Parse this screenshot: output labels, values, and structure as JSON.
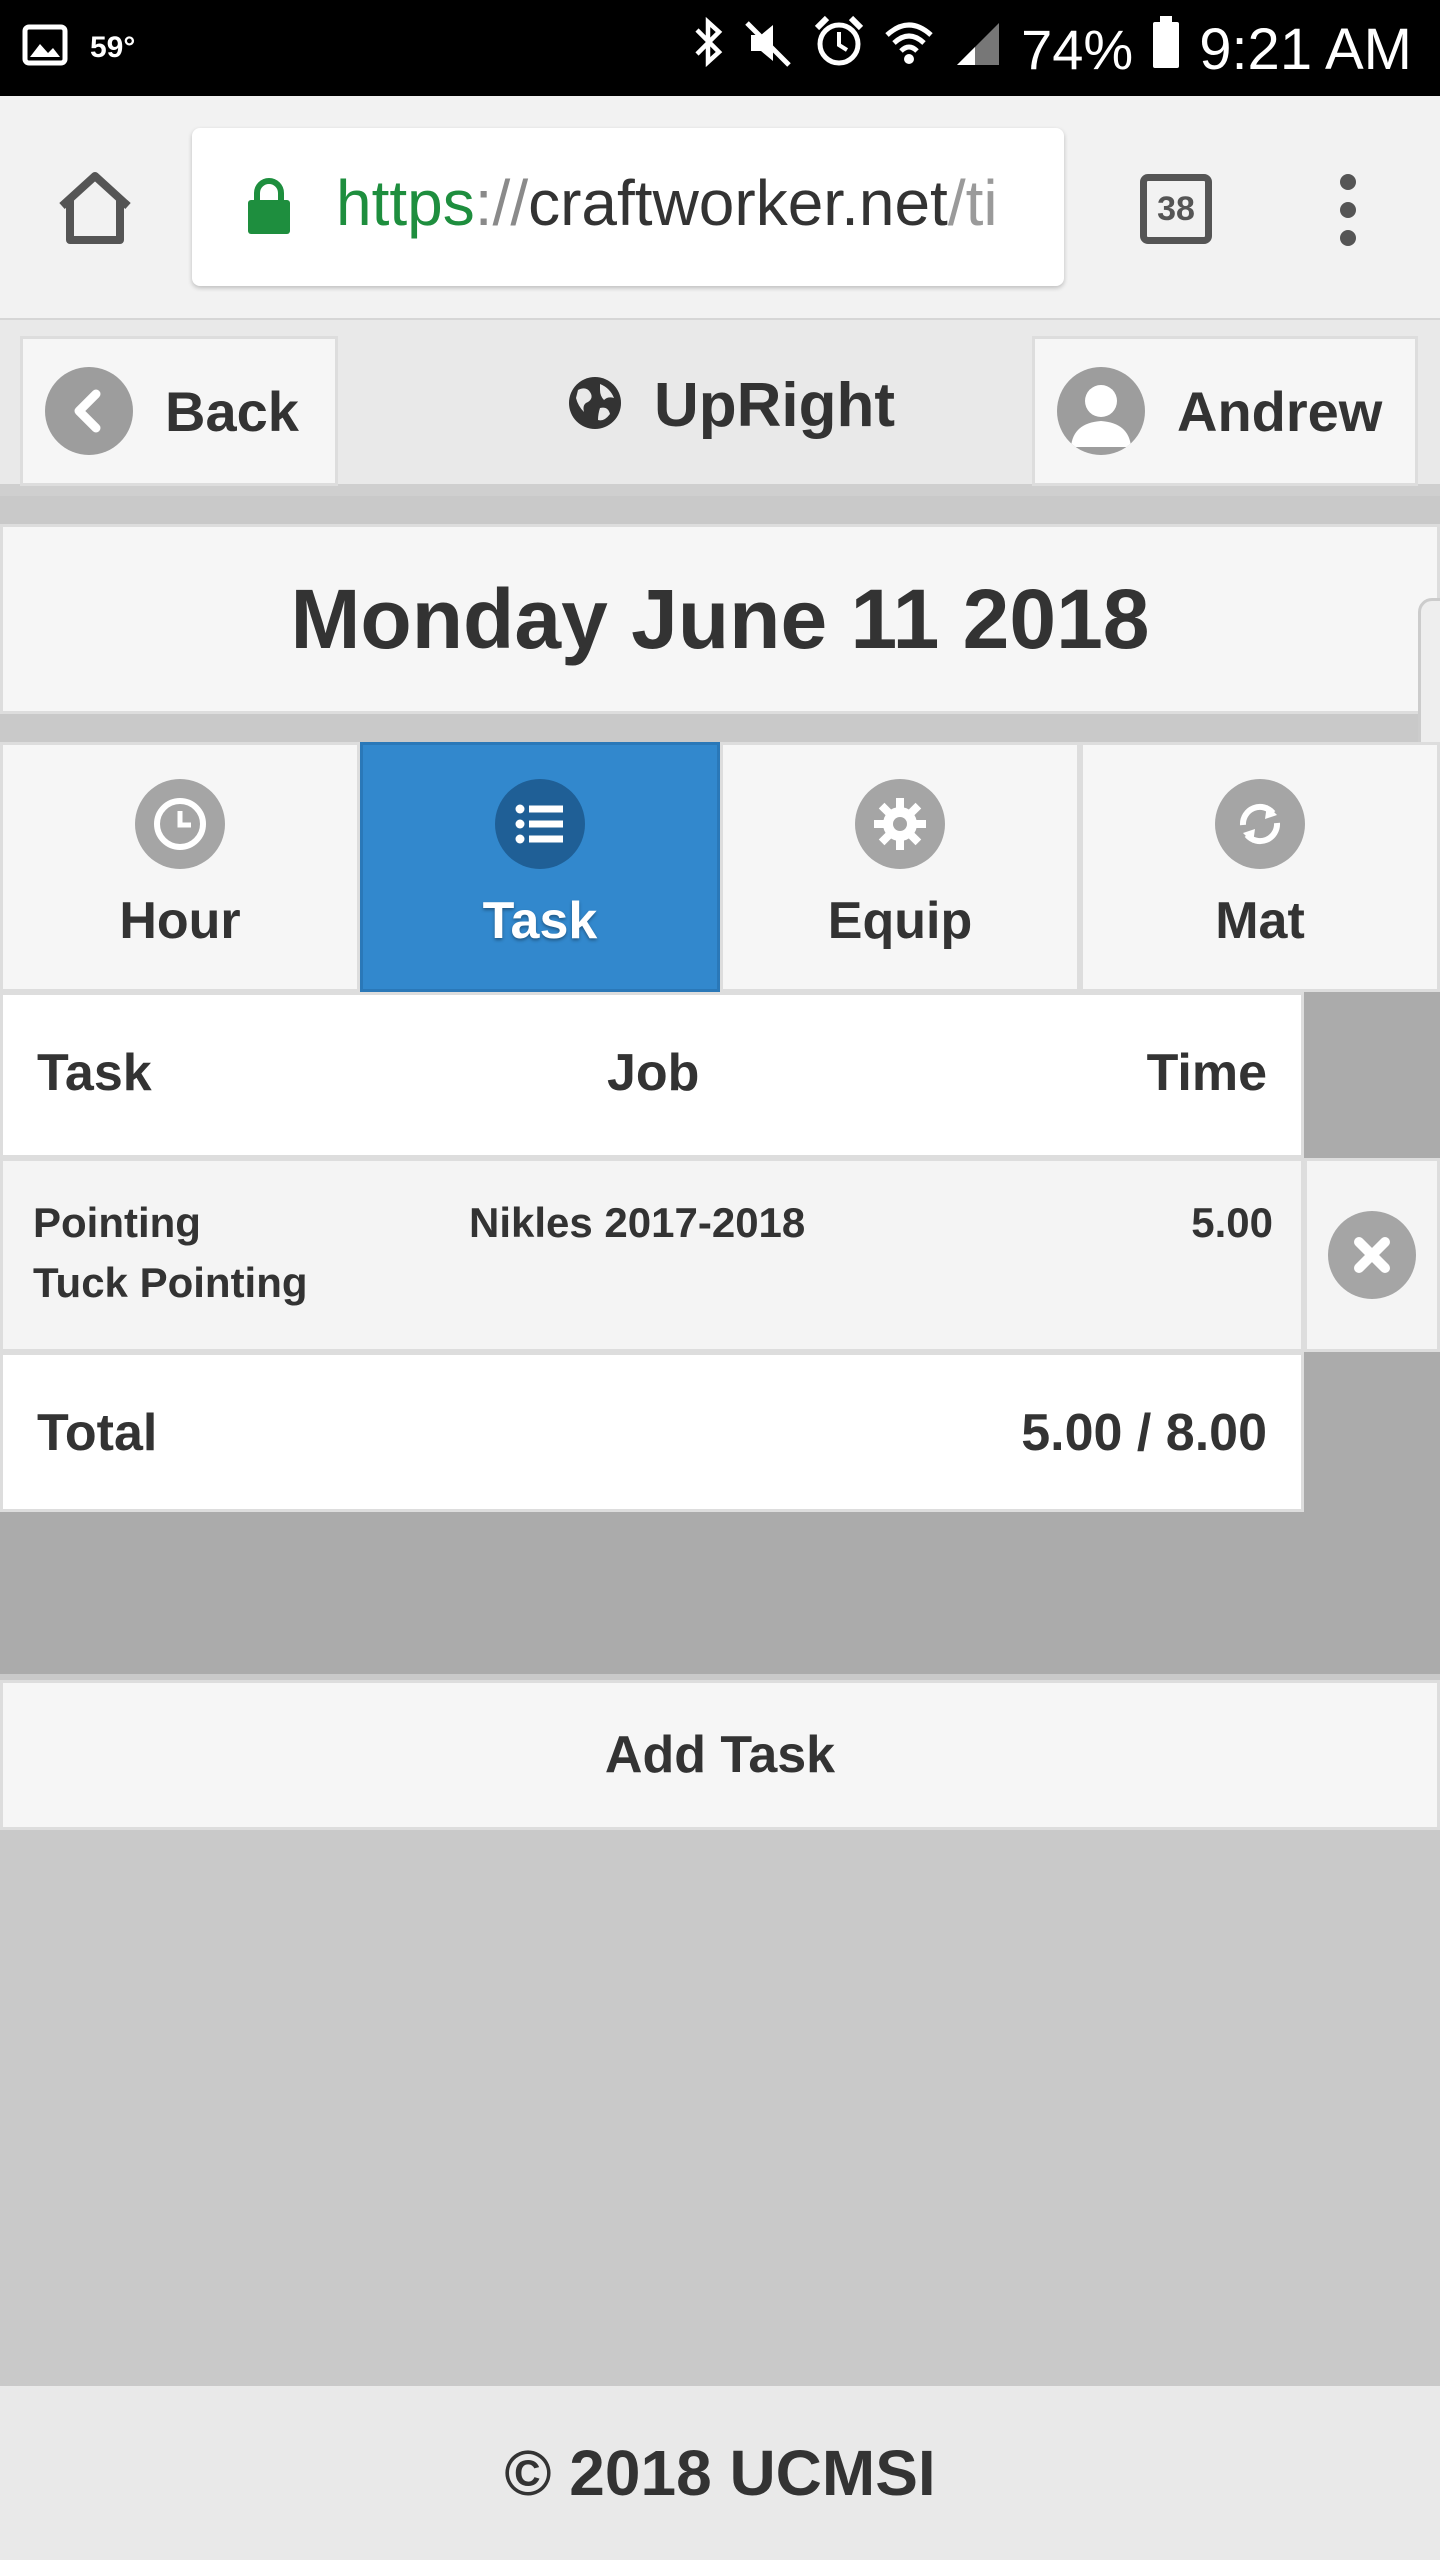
{
  "status_bar": {
    "temperature": "59°",
    "battery_percent": "74%",
    "time": "9:21 AM"
  },
  "browser": {
    "url_scheme": "https",
    "url_separator": "://",
    "url_host": "craftworker.net",
    "url_path": "/ti",
    "tab_count": "38"
  },
  "header": {
    "back_label": "Back",
    "brand_label": "UpRight",
    "user_label": "Andrew"
  },
  "date_title": "Monday June 11 2018",
  "tabs": [
    {
      "label": "Hour",
      "icon": "clock-icon",
      "active": false
    },
    {
      "label": "Task",
      "icon": "list-icon",
      "active": true
    },
    {
      "label": "Equip",
      "icon": "gear-icon",
      "active": false
    },
    {
      "label": "Mat",
      "icon": "refresh-icon",
      "active": false
    }
  ],
  "table": {
    "headers": {
      "task": "Task",
      "job": "Job",
      "time": "Time"
    },
    "rows": [
      {
        "task_line1": "Pointing",
        "task_line2": "Tuck Pointing",
        "job": "Nikles 2017-2018",
        "time": "5.00"
      }
    ],
    "total_label": "Total",
    "total_value": "5.00 / 8.00"
  },
  "add_task_label": "Add Task",
  "footer": "© 2018 UCMSI",
  "colors": {
    "active_tab": "#3288cd",
    "active_icon": "#1f5f96",
    "secure_green": "#1e8e3e"
  }
}
